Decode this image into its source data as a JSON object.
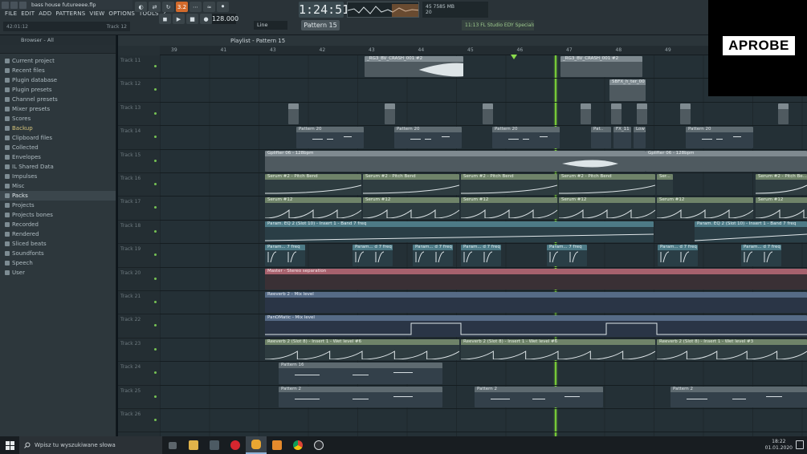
{
  "window": {
    "title": "bass house futureeee.flp",
    "hint_left": "42:01:12",
    "hint_right": "Track 12"
  },
  "menu": [
    "FILE",
    "EDIT",
    "ADD",
    "PATTERNS",
    "VIEW",
    "OPTIONS",
    "TOOLS",
    "?"
  ],
  "transport": {
    "time": "1:24:51",
    "tempo": "128.000",
    "pattern": "Pattern 15",
    "snap": "Line",
    "step_label": "3.2",
    "cpu_line1": "45  7585 MB",
    "cpu_line2": "20"
  },
  "news": "11:13  FL Studio EDY Specials!",
  "browser": {
    "title": "Browser - All",
    "items": [
      {
        "label": "Current project",
        "hl": false
      },
      {
        "label": "Recent files",
        "hl": false
      },
      {
        "label": "Plugin database",
        "hl": false
      },
      {
        "label": "Plugin presets",
        "hl": false
      },
      {
        "label": "Channel presets",
        "hl": false
      },
      {
        "label": "Mixer presets",
        "hl": false
      },
      {
        "label": "Scores",
        "hl": false
      },
      {
        "label": "Backup",
        "hl": true
      },
      {
        "label": "Clipboard files",
        "hl": false
      },
      {
        "label": "Collected",
        "hl": false
      },
      {
        "label": "Envelopes",
        "hl": false
      },
      {
        "label": "IL Shared Data",
        "hl": false
      },
      {
        "label": "Impulses",
        "hl": false
      },
      {
        "label": "Misc",
        "hl": false
      },
      {
        "label": "Packs",
        "hl": false,
        "selected": true
      },
      {
        "label": "Projects",
        "hl": false
      },
      {
        "label": "Projects bones",
        "hl": false
      },
      {
        "label": "Recorded",
        "hl": false
      },
      {
        "label": "Rendered",
        "hl": false
      },
      {
        "label": "Sliced beats",
        "hl": false
      },
      {
        "label": "Soundfonts",
        "hl": false
      },
      {
        "label": "Speech",
        "hl": false
      },
      {
        "label": "User",
        "hl": false
      }
    ]
  },
  "playlist": {
    "title": "Playlist - Pattern 15",
    "ruler": [
      "39",
      "41",
      "43",
      "42",
      "43",
      "44",
      "45",
      "46",
      "47",
      "48",
      "49"
    ],
    "tracks": [
      "Track 11",
      "Track 12",
      "Track 13",
      "Track 14",
      "Track 15",
      "Track 16",
      "Track 17",
      "Track 18",
      "Track 19",
      "Track 20",
      "Track 21",
      "Track 22",
      "Track 23",
      "Track 24",
      "Track 25",
      "Track 26"
    ],
    "clip_labels": {
      "riser_a": "_RG3_BV_CRASH_001 #2",
      "riser_b": "_RG3_BV_CRASH_001 #2",
      "sbfx": "SBFX_h_ter_00",
      "pattern20": "Pattern 20",
      "pattern20b": "Pattern 20",
      "pattern20c": "Pattern 20",
      "pattern20d": "Pattern 20",
      "pat": "Pat..",
      "fx11": "FX_11",
      "low": "Low_Fu...1_Rwd",
      "gliffer": "Gplifter 06 - 128bpm",
      "gliffer2": "Gplifter 06 - 128bpm",
      "serum_pb1": "Serum #2 - Pitch Bend",
      "serum_pb2": "Serum #2 - Pitch Bend",
      "serum_pb3": "Serum #2 - Pitch Bend",
      "serum_pb4": "Serum #2 - Pitch Bend",
      "serum_pb5": "Ser...",
      "serum_pb6": "Serum #2 - Pitch Be...",
      "serum12": "Serum #12",
      "param_eq": "Param. EQ 2 (Slot 10) - Insert 1 - Band 7 freq",
      "param_eq2": "Param. EQ 2 (Slot 10) - Insert 1 - Band 7 freq",
      "param_short": "Param... 7 freq",
      "param_short2": "Param... d 7 freq",
      "master": "Master - Stereo separation",
      "reverb_mix": "Reeverb 2 - Mix level",
      "panomatic": "PanOMatic - Mix level",
      "reverb_wet": "Reeverb 2 (Slot 8) - Insert 1 - Wet level #6",
      "reverb_wet2": "Reeverb 2 (Slot 8) - Insert 1 - Wet level #6",
      "reverb_wet3": "Reeverb 2 (Slot 8) - Insert 1 - Wet level #3",
      "pattern16": "Pattern 16",
      "pattern2": "Pattern 2"
    }
  },
  "overlay": {
    "text": "APROBE"
  },
  "taskbar": {
    "search_placeholder": "Wpisz tu wyszukiwane słowa",
    "time": "18:22",
    "date": "01.01.2020"
  }
}
